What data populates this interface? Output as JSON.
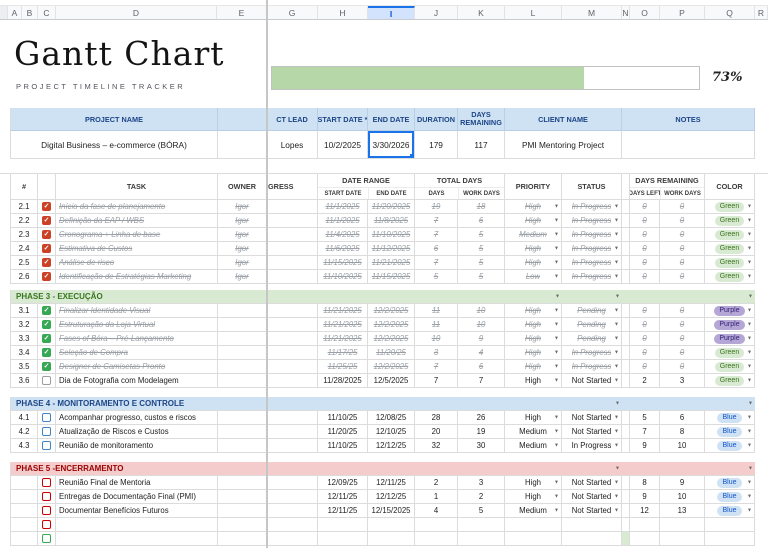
{
  "colors": {
    "selection_blue": "#1a73e8",
    "progress_fill": "#b6d7a8",
    "project_header_bg": "#cfe2f3",
    "project_header_fg": "#1c4587",
    "gridline": "#dcdcdc"
  },
  "phase_themes": {
    "green": {
      "bg": "#d9ead3",
      "fg": "#38761d"
    },
    "blue": {
      "bg": "#cfe2f3",
      "fg": "#1c4587"
    },
    "red": {
      "bg": "#f4cccc",
      "fg": "#990000"
    }
  },
  "color_chips": {
    "Green": {
      "bg": "#d9ead3",
      "fg": "#38761d"
    },
    "Purple": {
      "bg": "#b4a7d6",
      "fg": "#351c75"
    },
    "Blue": {
      "bg": "#cfe2f3",
      "fg": "#1155cc"
    }
  },
  "spreadsheet": {
    "column_letters": [
      "A",
      "B",
      "C",
      "D",
      "E",
      "G",
      "H",
      "I",
      "J",
      "K",
      "L",
      "M",
      "N",
      "O",
      "P",
      "Q",
      "R"
    ],
    "selected_column": "I"
  },
  "title_block": {
    "title": "Gantt Chart",
    "subtitle": "PROJECT TIMELINE TRACKER"
  },
  "progress": {
    "percent_label": "73%",
    "percent_value": 73
  },
  "project_table": {
    "headers": {
      "project_name": "PROJECT NAME",
      "project_lead": "CT LEAD",
      "start_date": "START DATE *",
      "end_date": "END DATE",
      "duration": "DURATION",
      "days_remaining": "DAYS REMAINING",
      "client_name": "CLIENT NAME",
      "notes": "NOTES"
    },
    "row": {
      "project_name": "Digital Business – e-commerce (BÓRA)",
      "project_lead": "Lopes",
      "start_date": "10/2/2025",
      "end_date": "3/30/2026",
      "duration": "179",
      "days_remaining": "117",
      "client_name": "PMI Mentoring Project",
      "notes": ""
    }
  },
  "task_table": {
    "headers": {
      "num": "#",
      "task": "TASK",
      "owner": "OWNER",
      "progress": "GRESS",
      "date_range": "DATE RANGE",
      "start_date": "START DATE",
      "end_date": "END DATE",
      "total_days": "TOTAL DAYS",
      "days": "DAYS",
      "work_days": "WORK DAYS",
      "priority": "PRIORITY",
      "status": "STATUS",
      "days_remaining": "DAYS REMAINING",
      "days_left": "DAYS LEFT",
      "work_days_2": "WORK DAYS",
      "color": "COLOR"
    },
    "rows": [
      {
        "type": "task",
        "num": "2.1",
        "task": "Início da fase de planejamento",
        "owner": "Igor",
        "struck": true,
        "checkbox": {
          "checked": true,
          "color": "#cc4125"
        },
        "start": "11/1/2025",
        "end": "11/20/2025",
        "days": "19",
        "work_days": "18",
        "priority": "High",
        "status": "In Progress",
        "days_left": "0",
        "work_days_left": "0",
        "color": "Green"
      },
      {
        "type": "task",
        "num": "2.2",
        "task": "Definição da EAP / WBS",
        "owner": "Igor",
        "struck": true,
        "checkbox": {
          "checked": true,
          "color": "#cc4125"
        },
        "start": "11/1/2025",
        "end": "11/8/2025",
        "days": "7",
        "work_days": "6",
        "priority": "High",
        "status": "In Progress",
        "days_left": "0",
        "work_days_left": "0",
        "color": "Green"
      },
      {
        "type": "task",
        "num": "2.3",
        "task": "Cronograma + Linha de base",
        "owner": "Igor",
        "struck": true,
        "checkbox": {
          "checked": true,
          "color": "#cc4125"
        },
        "start": "11/4/2025",
        "end": "11/10/2025",
        "days": "7",
        "work_days": "5",
        "priority": "Medium",
        "status": "In Progress",
        "days_left": "0",
        "work_days_left": "0",
        "color": "Green"
      },
      {
        "type": "task",
        "num": "2.4",
        "task": "Estimativa de Custos",
        "owner": "Igor",
        "struck": true,
        "checkbox": {
          "checked": true,
          "color": "#cc4125"
        },
        "start": "11/6/2025",
        "end": "11/12/2025",
        "days": "6",
        "work_days": "5",
        "priority": "High",
        "status": "In Progress",
        "days_left": "0",
        "work_days_left": "0",
        "color": "Green"
      },
      {
        "type": "task",
        "num": "2.5",
        "task": "Análise de risco",
        "owner": "Igor",
        "struck": true,
        "checkbox": {
          "checked": true,
          "color": "#cc4125"
        },
        "start": "11/15/2025",
        "end": "11/21/2025",
        "days": "7",
        "work_days": "5",
        "priority": "High",
        "status": "In Progress",
        "days_left": "0",
        "work_days_left": "0",
        "color": "Green"
      },
      {
        "type": "task",
        "num": "2.6",
        "task": "Identificação de Estratégias Marketing",
        "owner": "Igor",
        "struck": true,
        "checkbox": {
          "checked": true,
          "color": "#cc4125"
        },
        "start": "11/10/2025",
        "end": "11/15/2025",
        "days": "5",
        "work_days": "5",
        "priority": "Low",
        "status": "In Progress",
        "days_left": "0",
        "work_days_left": "0",
        "color": "Green"
      },
      {
        "type": "gap",
        "h": 6
      },
      {
        "type": "phase",
        "label": "PHASE 3 - EXECUÇÃO",
        "theme": "green",
        "carets": [
          "priority",
          "status",
          "color"
        ]
      },
      {
        "type": "task",
        "num": "3.1",
        "task": "Finalizar Identidade Visual",
        "owner": "",
        "struck": true,
        "checkbox": {
          "checked": true,
          "color": "#34a853"
        },
        "start": "11/21/2025",
        "end": "12/2/2025",
        "days": "11",
        "work_days": "10",
        "priority": "High",
        "status": "Pending",
        "days_left": "0",
        "work_days_left": "0",
        "color": "Purple"
      },
      {
        "type": "task",
        "num": "3.2",
        "task": "Estruturação da Loja Virtual",
        "owner": "",
        "struck": true,
        "checkbox": {
          "checked": true,
          "color": "#34a853"
        },
        "start": "11/21/2025",
        "end": "12/2/2025",
        "days": "11",
        "work_days": "10",
        "priority": "High",
        "status": "Pending",
        "days_left": "0",
        "work_days_left": "0",
        "color": "Purple"
      },
      {
        "type": "task",
        "num": "3.3",
        "task": "Fases of Bóra – Pré-Lançamento",
        "owner": "",
        "struck": true,
        "checkbox": {
          "checked": true,
          "color": "#34a853"
        },
        "start": "11/21/2025",
        "end": "12/2/2025",
        "days": "10",
        "work_days": "9",
        "priority": "High",
        "status": "Pending",
        "days_left": "0",
        "work_days_left": "0",
        "color": "Purple"
      },
      {
        "type": "task",
        "num": "3.4",
        "task": "Seleção de Compra",
        "owner": "",
        "struck": true,
        "checkbox": {
          "checked": true,
          "color": "#34a853"
        },
        "start": "11/17/25",
        "end": "11/20/25",
        "days": "3",
        "work_days": "4",
        "priority": "High",
        "status": "In Progress",
        "days_left": "0",
        "work_days_left": "0",
        "color": "Green"
      },
      {
        "type": "task",
        "num": "3.5",
        "task": "Designer de Camisetas Pronto",
        "owner": "",
        "struck": true,
        "checkbox": {
          "checked": true,
          "color": "#34a853"
        },
        "start": "11/25/25",
        "end": "12/2/2025",
        "days": "7",
        "work_days": "6",
        "priority": "High",
        "status": "In Progress",
        "days_left": "0",
        "work_days_left": "0",
        "color": "Green"
      },
      {
        "type": "task",
        "num": "3.6",
        "task": "Dia de Fotografia com Modelagem",
        "owner": "",
        "struck": false,
        "checkbox": {
          "checked": false,
          "color": "#9e9e9e"
        },
        "start": "11/28/2025",
        "end": "12/5/2025",
        "days": "7",
        "work_days": "7",
        "priority": "High",
        "status": "Not Started",
        "days_left": "2",
        "work_days_left": "3",
        "color": "Green"
      },
      {
        "type": "gap",
        "h": 9
      },
      {
        "type": "phase",
        "label": "PHASE 4 - MONITORAMENTO E CONTROLE",
        "theme": "blue",
        "carets": [
          "status",
          "color"
        ]
      },
      {
        "type": "task",
        "num": "4.1",
        "task": "Acompanhar progresso, custos e riscos",
        "owner": "",
        "struck": false,
        "checkbox": {
          "checked": false,
          "color": "#3d85c6"
        },
        "start": "11/10/25",
        "end": "12/08/25",
        "days": "28",
        "work_days": "26",
        "priority": "High",
        "status": "Not Started",
        "days_left": "5",
        "work_days_left": "6",
        "color": "Blue"
      },
      {
        "type": "task",
        "num": "4.2",
        "task": "Atualização de Riscos e Custos",
        "owner": "",
        "struck": false,
        "checkbox": {
          "checked": false,
          "color": "#3d85c6"
        },
        "start": "11/20/25",
        "end": "12/10/25",
        "days": "20",
        "work_days": "19",
        "priority": "Medium",
        "status": "Not Started",
        "days_left": "7",
        "work_days_left": "8",
        "color": "Blue"
      },
      {
        "type": "task",
        "num": "4.3",
        "task": "Reunião de monitoramento",
        "owner": "",
        "struck": false,
        "checkbox": {
          "checked": false,
          "color": "#3d85c6"
        },
        "start": "11/10/25",
        "end": "12/12/25",
        "days": "32",
        "work_days": "30",
        "priority": "Medium",
        "status": "In Progress",
        "days_left": "9",
        "work_days_left": "10",
        "color": "Blue"
      },
      {
        "type": "gap",
        "h": 9
      },
      {
        "type": "phase",
        "label": "PHASE 5 -ENCERRAMENTO",
        "theme": "red",
        "carets": [
          "status",
          "color"
        ]
      },
      {
        "type": "task",
        "num": "",
        "task": "Reunião Final de Mentoria",
        "owner": "",
        "struck": false,
        "checkbox": {
          "checked": false,
          "color": "#cc0000"
        },
        "start": "12/09/25",
        "end": "12/11/25",
        "days": "2",
        "work_days": "3",
        "priority": "High",
        "status": "Not Started",
        "days_left": "8",
        "work_days_left": "9",
        "color": "Blue"
      },
      {
        "type": "task",
        "num": "",
        "task": "Entregas de Documentação Final (PMI)",
        "owner": "",
        "struck": false,
        "checkbox": {
          "checked": false,
          "color": "#cc0000"
        },
        "start": "12/11/25",
        "end": "12/12/25",
        "days": "1",
        "work_days": "2",
        "priority": "High",
        "status": "Not Started",
        "days_left": "9",
        "work_days_left": "10",
        "color": "Blue"
      },
      {
        "type": "task",
        "num": "",
        "task": "Documentar Benefícios Futuros",
        "owner": "",
        "struck": false,
        "checkbox": {
          "checked": false,
          "color": "#cc0000"
        },
        "start": "12/11/25",
        "end": "12/15/2025",
        "days": "4",
        "work_days": "5",
        "priority": "Medium",
        "status": "Not Started",
        "days_left": "12",
        "work_days_left": "13",
        "color": "Blue"
      },
      {
        "type": "task",
        "num": "",
        "task": "",
        "owner": "",
        "struck": false,
        "checkbox": {
          "checked": false,
          "color": "#cc0000"
        },
        "start": "",
        "end": "",
        "days": "",
        "work_days": "",
        "priority": "",
        "status": "",
        "days_left": "",
        "work_days_left": "",
        "color": ""
      },
      {
        "type": "task",
        "num": "",
        "task": "",
        "owner": "",
        "struck": false,
        "checkbox": {
          "checked": false,
          "color": "#34a853"
        },
        "start": "",
        "end": "",
        "days": "",
        "work_days": "",
        "priority": "",
        "status": "",
        "days_left": "",
        "work_days_left": "",
        "color": "",
        "n_fill": true
      }
    ]
  }
}
